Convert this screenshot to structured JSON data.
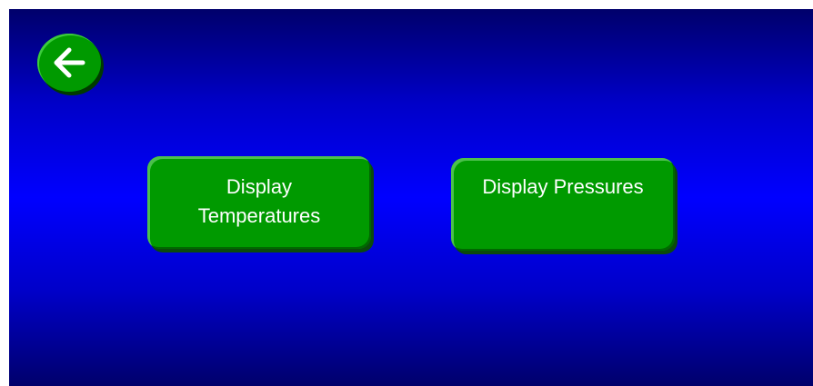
{
  "screen": {
    "background_colors": [
      "#00006b",
      "#0000ff"
    ],
    "back_button": {
      "icon": "arrow-left-icon",
      "color": "#009a00"
    },
    "buttons": [
      {
        "label": "Display Temperatures",
        "color": "#009a00"
      },
      {
        "label": "Display Pressures",
        "color": "#009a00"
      }
    ]
  }
}
